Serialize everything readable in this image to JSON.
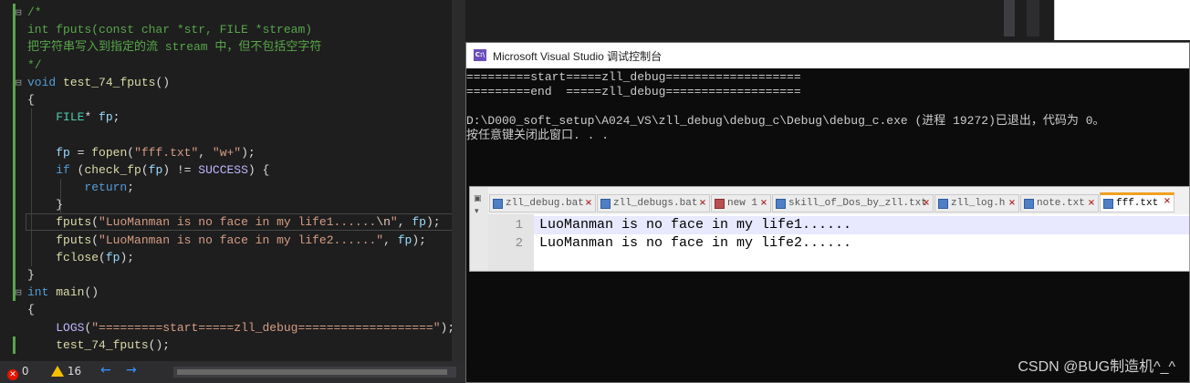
{
  "editor": {
    "lines": [
      {
        "segments": [
          {
            "t": "/*",
            "c": "cm"
          }
        ]
      },
      {
        "segments": [
          {
            "t": "int fputs(const char *str, FILE *stream)",
            "c": "cm"
          }
        ]
      },
      {
        "segments": [
          {
            "t": "把字符串写入到指定的流 stream 中，但不包括空字符",
            "c": "cm"
          }
        ]
      },
      {
        "segments": [
          {
            "t": "*/",
            "c": "cm"
          }
        ]
      },
      {
        "segments": [
          {
            "t": "void",
            "c": "kw"
          },
          {
            "t": " "
          },
          {
            "t": "test_74_fputs",
            "c": "fn"
          },
          {
            "t": "()"
          }
        ]
      },
      {
        "segments": [
          {
            "t": "{"
          }
        ]
      },
      {
        "segments": [
          {
            "t": "    "
          },
          {
            "t": "FILE",
            "c": "ty"
          },
          {
            "t": "* "
          },
          {
            "t": "fp",
            "c": "pm"
          },
          {
            "t": ";"
          }
        ]
      },
      {
        "segments": [
          {
            "t": ""
          }
        ]
      },
      {
        "segments": [
          {
            "t": "    "
          },
          {
            "t": "fp",
            "c": "pm"
          },
          {
            "t": " = "
          },
          {
            "t": "fopen",
            "c": "fn"
          },
          {
            "t": "("
          },
          {
            "t": "\"fff.txt\"",
            "c": "str"
          },
          {
            "t": ", "
          },
          {
            "t": "\"w+\"",
            "c": "str"
          },
          {
            "t": ");"
          }
        ]
      },
      {
        "segments": [
          {
            "t": "    "
          },
          {
            "t": "if",
            "c": "kw"
          },
          {
            "t": " ("
          },
          {
            "t": "check_fp",
            "c": "fn"
          },
          {
            "t": "("
          },
          {
            "t": "fp",
            "c": "pm"
          },
          {
            "t": ") != "
          },
          {
            "t": "SUCCESS",
            "c": "mac"
          },
          {
            "t": ") {"
          }
        ]
      },
      {
        "segments": [
          {
            "t": "        "
          },
          {
            "t": "return",
            "c": "kw"
          },
          {
            "t": ";"
          }
        ]
      },
      {
        "segments": [
          {
            "t": "    }"
          }
        ]
      },
      {
        "segments": [
          {
            "t": "    "
          },
          {
            "t": "fputs",
            "c": "fn"
          },
          {
            "t": "("
          },
          {
            "t": "\"LuoManman is no face in my life1......",
            "c": "str"
          },
          {
            "t": "\\n",
            "c": "esc"
          },
          {
            "t": "\"",
            "c": "str"
          },
          {
            "t": ", "
          },
          {
            "t": "fp",
            "c": "pm"
          },
          {
            "t": ");"
          }
        ]
      },
      {
        "segments": [
          {
            "t": "    "
          },
          {
            "t": "fputs",
            "c": "fn"
          },
          {
            "t": "("
          },
          {
            "t": "\"LuoManman is no face in my life2......\"",
            "c": "str"
          },
          {
            "t": ", "
          },
          {
            "t": "fp",
            "c": "pm"
          },
          {
            "t": ");"
          }
        ]
      },
      {
        "segments": [
          {
            "t": "    "
          },
          {
            "t": "fclose",
            "c": "fn"
          },
          {
            "t": "("
          },
          {
            "t": "fp",
            "c": "pm"
          },
          {
            "t": ");"
          }
        ]
      },
      {
        "segments": [
          {
            "t": "}"
          }
        ]
      },
      {
        "segments": [
          {
            "t": "int",
            "c": "kw"
          },
          {
            "t": " "
          },
          {
            "t": "main",
            "c": "fn"
          },
          {
            "t": "()"
          }
        ]
      },
      {
        "segments": [
          {
            "t": "{"
          }
        ]
      },
      {
        "segments": [
          {
            "t": "    "
          },
          {
            "t": "LOGS",
            "c": "mac"
          },
          {
            "t": "("
          },
          {
            "t": "\"=========start=====zll_debug===================\"",
            "c": "str"
          },
          {
            "t": ");"
          }
        ]
      },
      {
        "segments": [
          {
            "t": "    "
          },
          {
            "t": "test_74_fputs",
            "c": "fn"
          },
          {
            "t": "();"
          }
        ]
      }
    ]
  },
  "statusbar": {
    "errors": "0",
    "warnings": "16",
    "back_arrow": "←",
    "forward_arrow": "→"
  },
  "console": {
    "title": "Microsoft Visual Studio 调试控制台",
    "icon_text": "C:\\",
    "lines": [
      "=========start=====zll_debug===================",
      "=========end  =====zll_debug===================",
      "",
      "D:\\D000_soft_setup\\A024_VS\\zll_debug\\debug_c\\Debug\\debug_c.exe (进程 19272)已退出，代码为 0。",
      "按任意键关闭此窗口. . ."
    ]
  },
  "notepad": {
    "side_glyphs": [
      "▣",
      "▾"
    ],
    "tabs": [
      {
        "label": "zll_debug.bat",
        "icon": "blue"
      },
      {
        "label": "zll_debugs.bat",
        "icon": "blue"
      },
      {
        "label": "new 1",
        "icon": "red"
      },
      {
        "label": "skill_of_Dos_by_zll.txt",
        "icon": "blue"
      },
      {
        "label": "zll_log.h",
        "icon": "blue"
      },
      {
        "label": "note.txt",
        "icon": "blue"
      },
      {
        "label": "fff.txt",
        "icon": "blue",
        "active": true
      }
    ],
    "close_glyph": "×",
    "lines": [
      {
        "num": "1",
        "text": "LuoManman is no face in my life1......"
      },
      {
        "num": "2",
        "text": "LuoManman is no face in my life2......"
      }
    ]
  },
  "watermark": "CSDN @BUG制造机^_^"
}
